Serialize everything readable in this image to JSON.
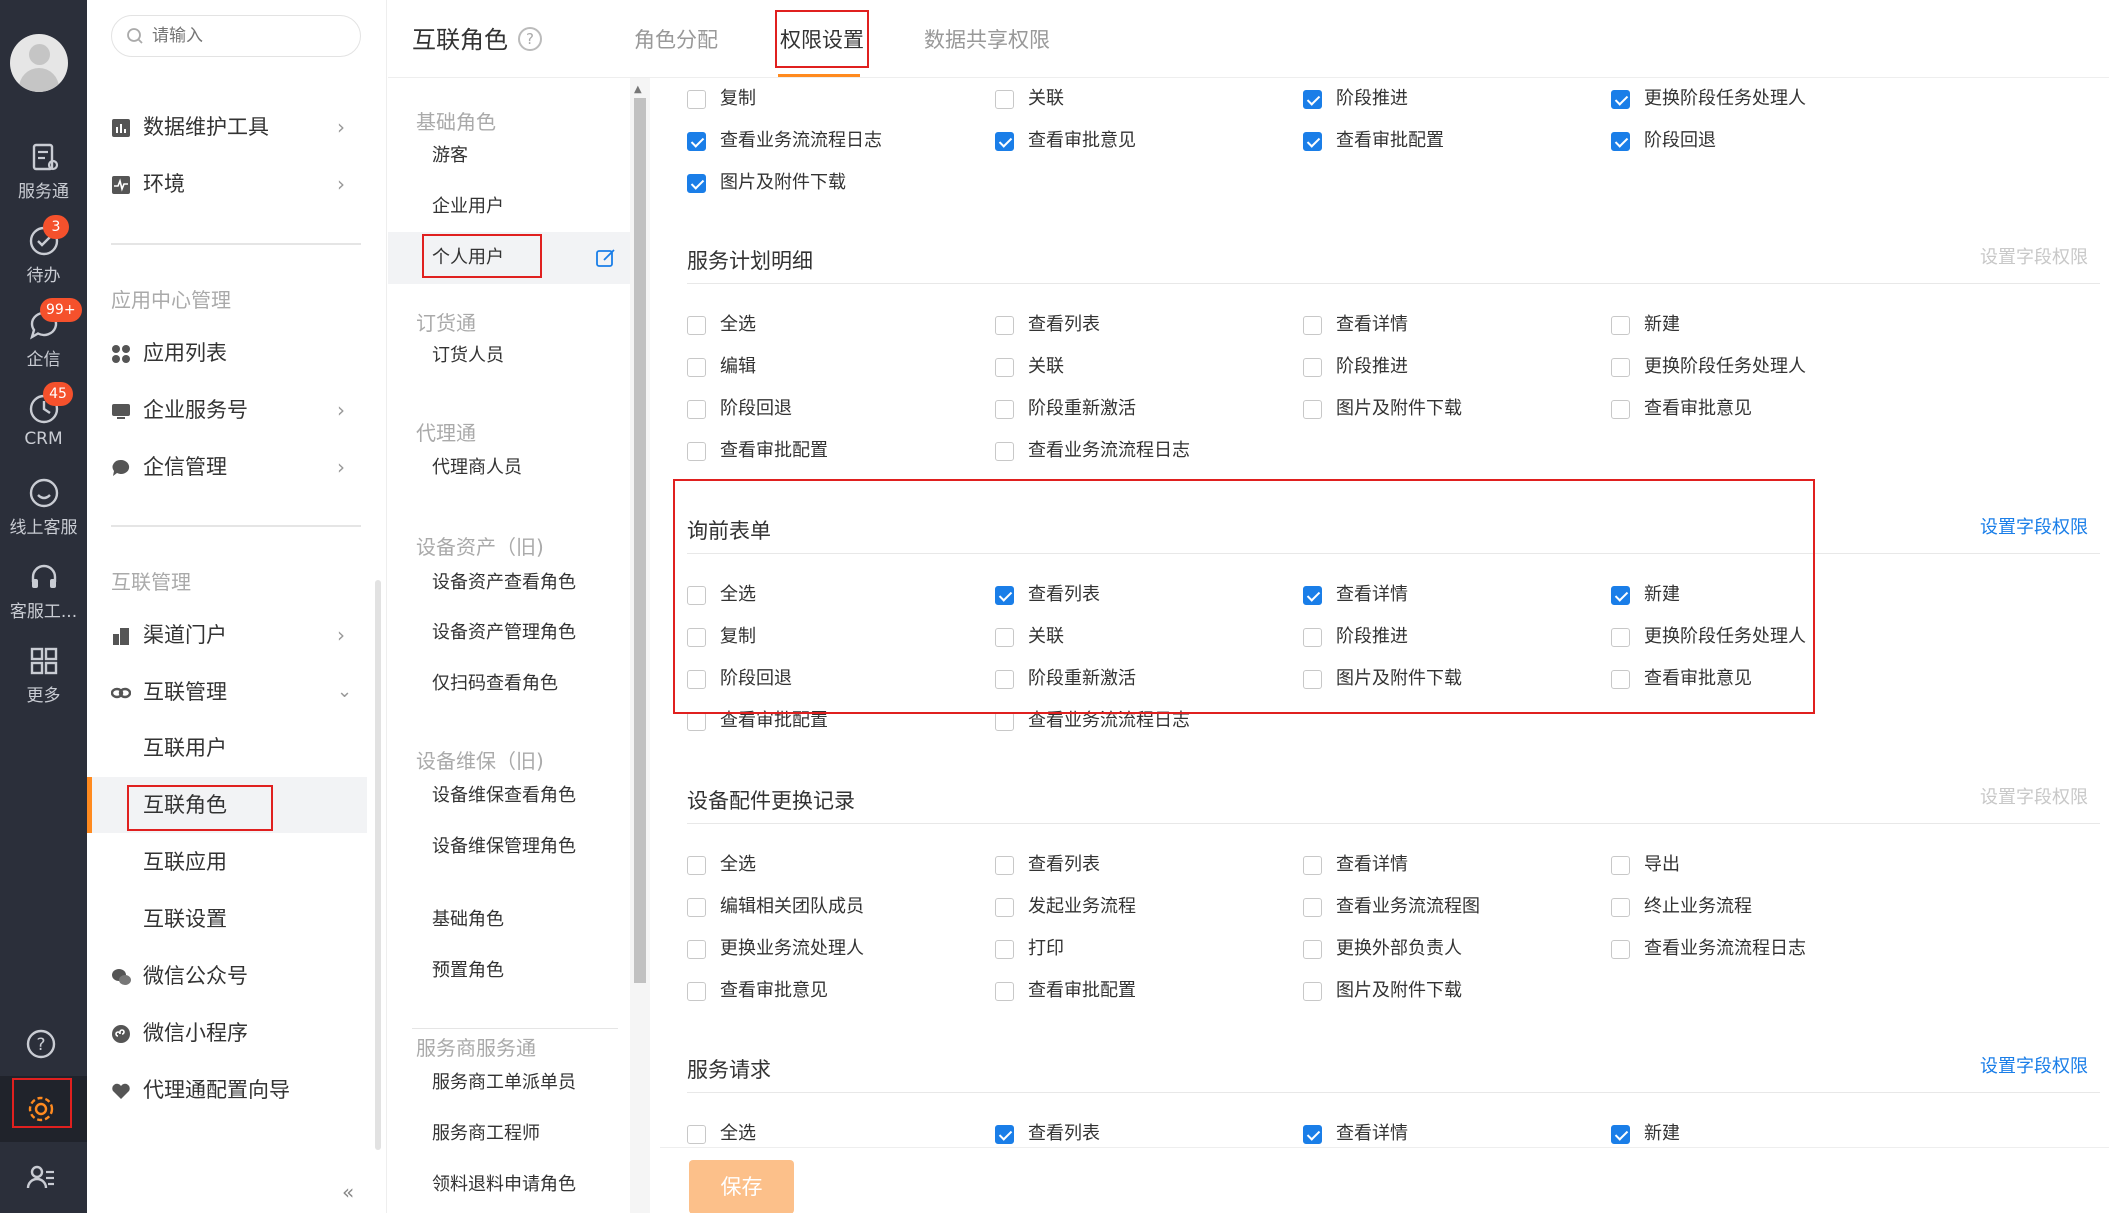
{
  "rail": {
    "items": [
      {
        "label": "服务通",
        "icon": "service-icon"
      },
      {
        "label": "待办",
        "icon": "todo-icon",
        "badge": "3"
      },
      {
        "label": "企信",
        "icon": "chat-icon",
        "badge": "99+"
      },
      {
        "label": "CRM",
        "icon": "crm-icon",
        "badge": "45"
      },
      {
        "label": "线上客服",
        "icon": "online-service-icon"
      },
      {
        "label": "客服工...",
        "icon": "headset-icon"
      },
      {
        "label": "更多",
        "icon": "more-grid-icon"
      }
    ]
  },
  "nav": {
    "search_placeholder": "请输入",
    "items": {
      "data_tools": "数据维护工具",
      "env": "环境",
      "app_list": "应用列表",
      "enterprise_service": "企业服务号",
      "qixin_admin": "企信管理",
      "channel_portal": "渠道门户",
      "interconnect_admin": "互联管理",
      "interconnect_users": "互联用户",
      "interconnect_roles": "互联角色",
      "interconnect_apps": "互联应用",
      "interconnect_settings": "互联设置",
      "wechat_official": "微信公众号",
      "wechat_mini": "微信小程序",
      "agent_wizard": "代理通配置向导"
    },
    "groups": {
      "app_center": "应用中心管理",
      "interconnect": "互联管理"
    },
    "collapse": "«"
  },
  "header": {
    "title": "互联角色",
    "help": "?",
    "tabs": [
      "角色分配",
      "权限设置",
      "数据共享权限"
    ]
  },
  "roles": {
    "groups": [
      {
        "name": "基础角色",
        "items": [
          "游客",
          "企业用户",
          "个人用户"
        ]
      },
      {
        "name": "订货通",
        "items": [
          "订货人员"
        ]
      },
      {
        "name": "代理通",
        "items": [
          "代理商人员"
        ]
      },
      {
        "name": "设备资产（旧)",
        "items": [
          "设备资产查看角色",
          "设备资产管理角色",
          "仅扫码查看角色"
        ]
      },
      {
        "name": "设备维保（旧)",
        "items": [
          "设备维保查看角色",
          "设备维保管理角色"
        ]
      },
      {
        "name": "",
        "items": [
          "基础角色",
          "预置角色"
        ]
      },
      {
        "name": "服务商服务通",
        "items": [
          "服务商工单派单员",
          "服务商工程师",
          "领料退料申请角色"
        ]
      }
    ]
  },
  "permissions": {
    "field_link": "设置字段权限",
    "save": "保存",
    "top_rows": [
      [
        {
          "label": "复制",
          "checked": false
        },
        {
          "label": "关联",
          "checked": false
        },
        {
          "label": "阶段推进",
          "checked": true
        },
        {
          "label": "更换阶段任务处理人",
          "checked": true
        }
      ],
      [
        {
          "label": "查看业务流流程日志",
          "checked": true
        },
        {
          "label": "查看审批意见",
          "checked": true
        },
        {
          "label": "查看审批配置",
          "checked": true
        },
        {
          "label": "阶段回退",
          "checked": true
        }
      ],
      [
        {
          "label": "图片及附件下载",
          "checked": true
        }
      ]
    ],
    "sections": [
      {
        "title": "服务计划明细",
        "link_enabled": false,
        "rows": [
          [
            {
              "label": "全选",
              "checked": false
            },
            {
              "label": "查看列表",
              "checked": false
            },
            {
              "label": "查看详情",
              "checked": false
            },
            {
              "label": "新建",
              "checked": false
            }
          ],
          [
            {
              "label": "编辑",
              "checked": false
            },
            {
              "label": "关联",
              "checked": false
            },
            {
              "label": "阶段推进",
              "checked": false
            },
            {
              "label": "更换阶段任务处理人",
              "checked": false
            }
          ],
          [
            {
              "label": "阶段回退",
              "checked": false
            },
            {
              "label": "阶段重新激活",
              "checked": false
            },
            {
              "label": "图片及附件下载",
              "checked": false
            },
            {
              "label": "查看审批意见",
              "checked": false
            }
          ],
          [
            {
              "label": "查看审批配置",
              "checked": false
            },
            {
              "label": "查看业务流流程日志",
              "checked": false
            }
          ]
        ]
      },
      {
        "title": "询前表单",
        "link_enabled": true,
        "rows": [
          [
            {
              "label": "全选",
              "checked": false
            },
            {
              "label": "查看列表",
              "checked": true
            },
            {
              "label": "查看详情",
              "checked": true
            },
            {
              "label": "新建",
              "checked": true
            }
          ],
          [
            {
              "label": "复制",
              "checked": false
            },
            {
              "label": "关联",
              "checked": false
            },
            {
              "label": "阶段推进",
              "checked": false
            },
            {
              "label": "更换阶段任务处理人",
              "checked": false
            }
          ],
          [
            {
              "label": "阶段回退",
              "checked": false
            },
            {
              "label": "阶段重新激活",
              "checked": false
            },
            {
              "label": "图片及附件下载",
              "checked": false
            },
            {
              "label": "查看审批意见",
              "checked": false
            }
          ],
          [
            {
              "label": "查看审批配置",
              "checked": false
            },
            {
              "label": "查看业务流流程日志",
              "checked": false
            }
          ]
        ]
      },
      {
        "title": "设备配件更换记录",
        "link_enabled": false,
        "rows": [
          [
            {
              "label": "全选",
              "checked": false
            },
            {
              "label": "查看列表",
              "checked": false
            },
            {
              "label": "查看详情",
              "checked": false
            },
            {
              "label": "导出",
              "checked": false
            }
          ],
          [
            {
              "label": "编辑相关团队成员",
              "checked": false
            },
            {
              "label": "发起业务流程",
              "checked": false
            },
            {
              "label": "查看业务流流程图",
              "checked": false
            },
            {
              "label": "终止业务流程",
              "checked": false
            }
          ],
          [
            {
              "label": "更换业务流处理人",
              "checked": false
            },
            {
              "label": "打印",
              "checked": false
            },
            {
              "label": "更换外部负责人",
              "checked": false
            },
            {
              "label": "查看业务流流程日志",
              "checked": false
            }
          ],
          [
            {
              "label": "查看审批意见",
              "checked": false
            },
            {
              "label": "查看审批配置",
              "checked": false
            },
            {
              "label": "图片及附件下载",
              "checked": false
            }
          ]
        ]
      },
      {
        "title": "服务请求",
        "link_enabled": true,
        "rows": [
          [
            {
              "label": "全选",
              "checked": false
            },
            {
              "label": "查看列表",
              "checked": true
            },
            {
              "label": "查看详情",
              "checked": true
            },
            {
              "label": "新建",
              "checked": true
            }
          ]
        ]
      }
    ]
  }
}
